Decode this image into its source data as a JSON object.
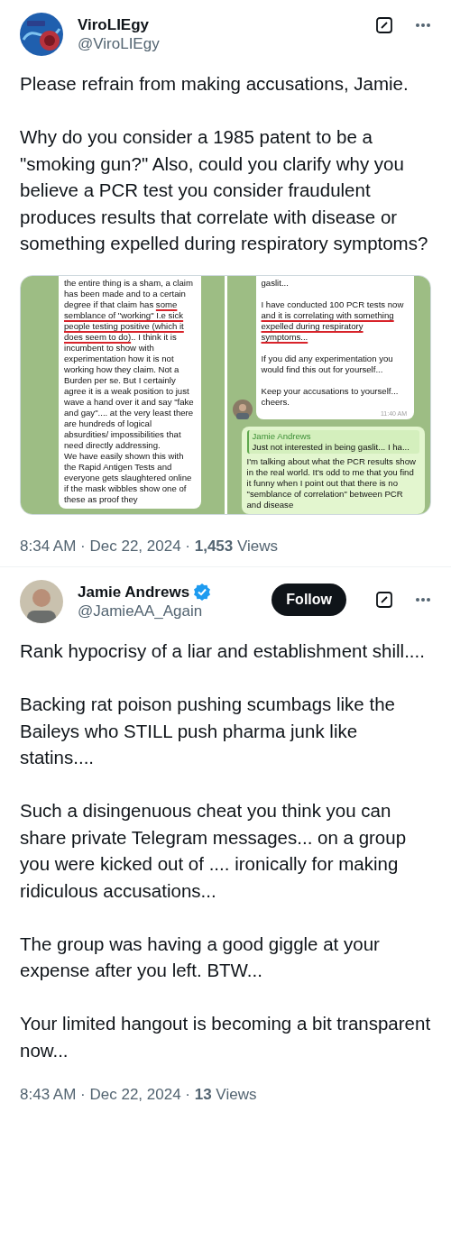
{
  "posts": [
    {
      "author": {
        "name": "ViroLIEgy",
        "handle": "@ViroLIEgy",
        "verified": false,
        "avatar": {
          "kind": "logo"
        }
      },
      "paragraphs": [
        "Please refrain from making accusations, Jamie.",
        "Why do you consider a 1985 patent to be a \"smoking gun?\" Also, could you clarify why you believe a PCR test you consider fraudulent produces results that correlate with disease or something expelled during respiratory symptoms?"
      ],
      "attachment": {
        "panels": [
          {
            "messages": [
              {
                "kind": "incoming",
                "avatar": false,
                "segments": [
                  {
                    "text": "the entire thing is a sham, a claim has been made and to a certain degree if that claim has ",
                    "underlined": false
                  },
                  {
                    "text": "some semblance of \"working\" I.e sick people testing positive (which it does seem to do)",
                    "underlined": true
                  },
                  {
                    "text": ".. I think it is incumbent to show with experimentation how it is not working how they claim. Not a Burden per se. But I certainly agree it is a weak position to just wave a hand over it and say \"fake and gay\".... at the very least there are hundreds of logical absurdities/ impossibilities that need directly addressing.\nWe have easily shown this with the Rapid Antigen Tests and everyone gets slaughtered online if the mask wibbles show one of these as proof they",
                    "underlined": false
                  }
                ]
              }
            ]
          },
          {
            "messages": [
              {
                "kind": "incoming",
                "avatar": true,
                "time": "11:40 AM",
                "segments": [
                  {
                    "text": "gaslit...\n\nI have conducted 100 PCR tests now ",
                    "underlined": false
                  },
                  {
                    "text": "and it is correlating with something expelled during respiratory symptoms...",
                    "underlined": true
                  },
                  {
                    "text": "\n\nIf you did any experimentation you would find this out for yourself...\n\nKeep your accusations to yourself... cheers.",
                    "underlined": false
                  }
                ]
              },
              {
                "kind": "outgoing",
                "avatar": false,
                "reply_to": {
                  "name": "Jamie Andrews",
                  "text": "Just not interested in being gaslit... I ha..."
                },
                "segments": [
                  {
                    "text": "I'm talking about what the PCR results show in the real world. It's odd to me that you find it funny when I point out that there is no \"semblance of correlation\" between PCR and disease",
                    "underlined": false
                  }
                ]
              }
            ]
          }
        ]
      },
      "meta": "8:34 AM · Dec 22, 2024 · **1,453** Views"
    },
    {
      "author": {
        "name": "Jamie Andrews",
        "handle": "@JamieAA_Again",
        "verified": true,
        "avatar": {
          "kind": "photo"
        }
      },
      "follow_button": "Follow",
      "paragraphs": [
        "Rank hypocrisy of a liar and establishment shill....",
        "Backing rat poison pushing scumbags like the Baileys who STILL push pharma junk like statins....",
        "Such a disingenuous cheat you think you can share private Telegram messages... on a group you were kicked out of .... ironically for making ridiculous accusations...",
        "The group was having a good giggle at your expense after you left. BTW...",
        "Your limited hangout is becoming a bit transparent now..."
      ],
      "meta": "8:43 AM · Dec 22, 2024 · **13** Views"
    }
  ]
}
